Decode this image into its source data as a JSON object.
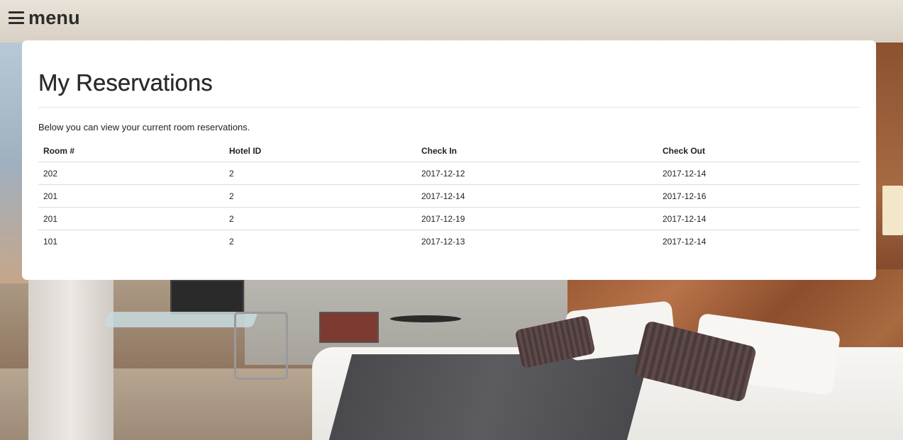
{
  "menu": {
    "icon": "hamburger-icon",
    "label": "menu"
  },
  "page": {
    "title": "My Reservations",
    "intro": "Below you can view your current room reservations."
  },
  "reservations": {
    "columns": [
      "Room #",
      "Hotel ID",
      "Check In",
      "Check Out"
    ],
    "rows": [
      {
        "room": "202",
        "hotel_id": "2",
        "check_in": "2017-12-12",
        "check_out": "2017-12-14"
      },
      {
        "room": "201",
        "hotel_id": "2",
        "check_in": "2017-12-14",
        "check_out": "2017-12-16"
      },
      {
        "room": "201",
        "hotel_id": "2",
        "check_in": "2017-12-19",
        "check_out": "2017-12-14"
      },
      {
        "room": "101",
        "hotel_id": "2",
        "check_in": "2017-12-13",
        "check_out": "2017-12-14"
      }
    ]
  },
  "colors": {
    "card_background": "#ffffff",
    "text": "#222222",
    "row_divider": "#dcdcdc"
  }
}
